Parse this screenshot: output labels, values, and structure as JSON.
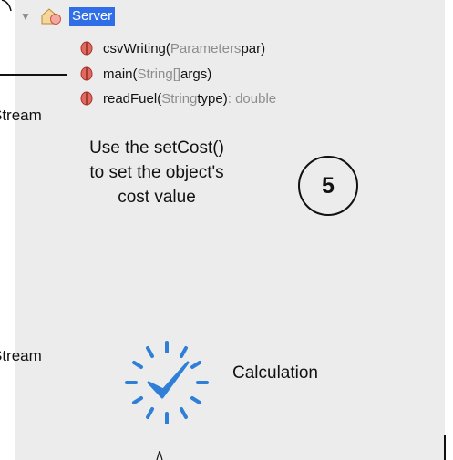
{
  "tree": {
    "root": {
      "label": "Server",
      "icon": "class-icon",
      "expanded": true
    },
    "methods": [
      {
        "name": "csvWriting(",
        "params": [
          {
            "type": "Parameters",
            "name": " par"
          }
        ],
        "close": ")",
        "return": "",
        "icon": "method-icon"
      },
      {
        "name": "main(",
        "params": [
          {
            "type": "String[]",
            "name": " args"
          }
        ],
        "close": ")",
        "return": "",
        "icon": "method-icon"
      },
      {
        "name": "readFuel(",
        "params": [
          {
            "type": "String",
            "name": " type"
          }
        ],
        "close": ")",
        "return": " : double",
        "icon": "method-icon"
      }
    ]
  },
  "left_labels": [
    "Stream",
    "Stream"
  ],
  "annotation": {
    "lines": [
      "Use the setCost()",
      "to set the object's",
      "cost value"
    ],
    "step_number": "5"
  },
  "calculation": {
    "label": "Calculation",
    "icon": "check-spinner-icon",
    "color": "#2f7fd8"
  },
  "colors": {
    "selection": "#2f6ee7",
    "panel": "#ececec",
    "method_icon": "#d0453f"
  }
}
